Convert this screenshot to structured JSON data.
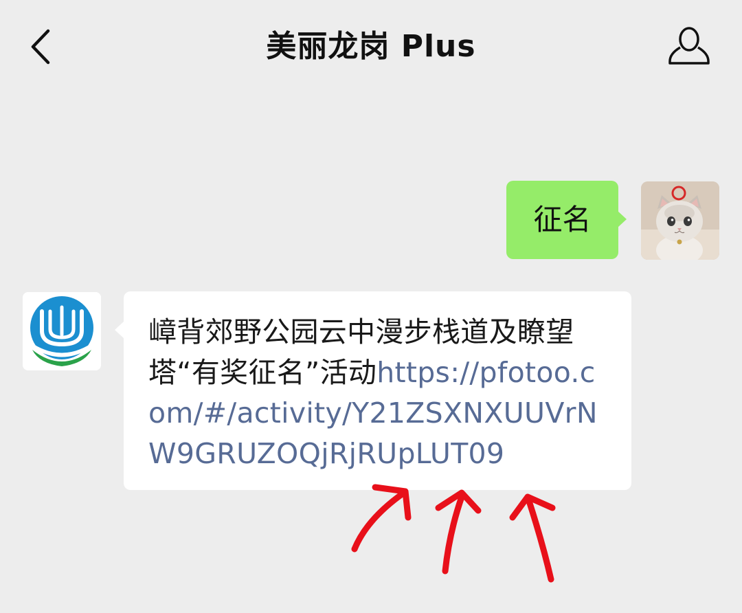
{
  "header": {
    "title": "美丽龙岗 Plus",
    "back_icon": "chevron-left-icon",
    "profile_icon": "person-icon"
  },
  "messages": [
    {
      "direction": "outgoing",
      "text": "征名",
      "avatar": "cat-avatar"
    },
    {
      "direction": "incoming",
      "avatar": "official-account-logo",
      "text": "嶂背郊野公园云中漫步栈道及瞭望塔“有奖征名”活动",
      "link": "https://pfotoo.com/#/activity/Y21ZSXNXUUVrNW9GRUZOQjRjRUpLUT09"
    }
  ],
  "annotation": {
    "arrow_count": 3,
    "color": "#e8101a"
  },
  "colors": {
    "background": "#ededed",
    "outgoing_bubble": "#95ec69",
    "incoming_bubble": "#ffffff",
    "link": "#576b95"
  }
}
